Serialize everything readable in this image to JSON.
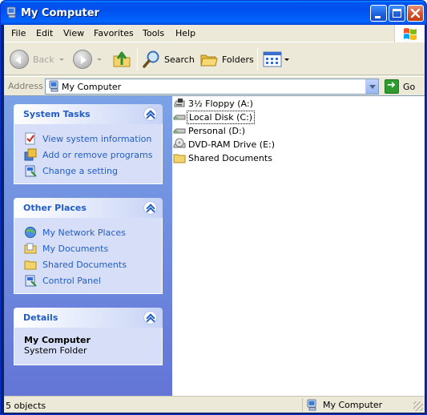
{
  "window": {
    "title": "My Computer",
    "title_icon": "my-computer-icon"
  },
  "menubar": {
    "items": [
      "File",
      "Edit",
      "View",
      "Favorites",
      "Tools",
      "Help"
    ]
  },
  "toolbar": {
    "back_label": "Back",
    "search_label": "Search",
    "folders_label": "Folders"
  },
  "addressbar": {
    "label": "Address",
    "value": "My Computer",
    "go_label": "Go"
  },
  "taskpane": {
    "system_tasks": {
      "title": "System Tasks",
      "items": [
        "View system information",
        "Add or remove programs",
        "Change a setting"
      ]
    },
    "other_places": {
      "title": "Other Places",
      "items": [
        "My Network Places",
        "My Documents",
        "Shared Documents",
        "Control Panel"
      ]
    },
    "details": {
      "title": "Details",
      "name": "My Computer",
      "type": "System Folder"
    }
  },
  "files": [
    {
      "name": "3½ Floppy (A:)",
      "icon": "floppy-drive-icon"
    },
    {
      "name": "Local Disk (C:)",
      "icon": "hard-disk-icon"
    },
    {
      "name": "Personal (D:)",
      "icon": "hard-disk-icon"
    },
    {
      "name": "DVD-RAM Drive (E:)",
      "icon": "dvd-drive-icon"
    },
    {
      "name": "Shared Documents",
      "icon": "folder-icon"
    }
  ],
  "statusbar": {
    "count": "5 objects",
    "location": "My Computer"
  },
  "colors": {
    "titlebar": "#0053ee",
    "taskpane_link": "#215dc6",
    "taskpane_bg_top": "#7ba2e7",
    "taskpane_bg_bottom": "#6375d6"
  }
}
